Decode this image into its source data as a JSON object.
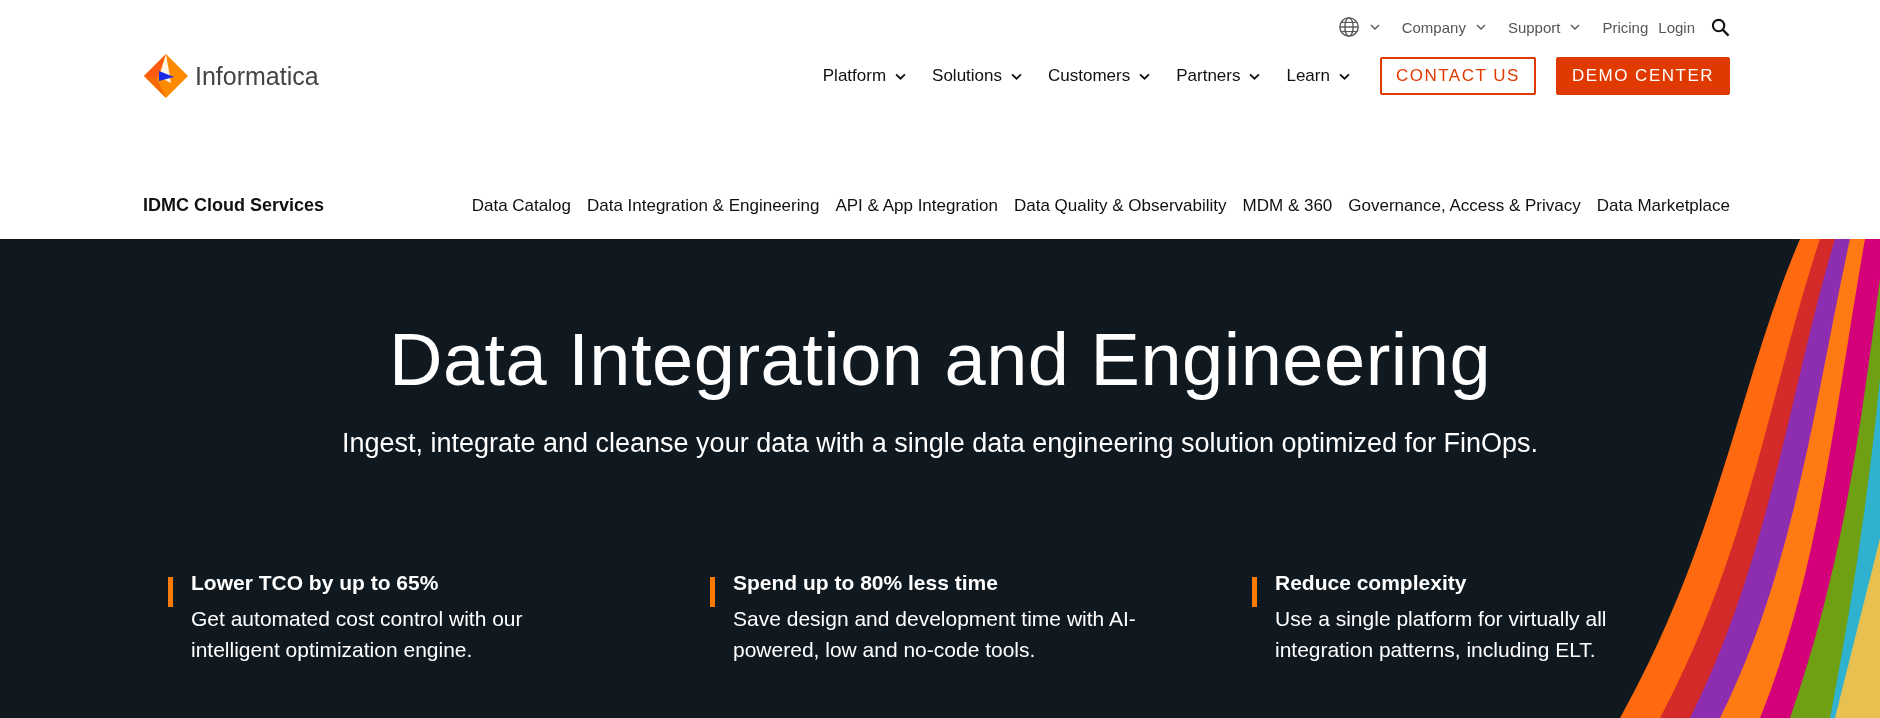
{
  "brand": {
    "name": "Informatica"
  },
  "utility_nav": [
    {
      "label": "Company",
      "dropdown": true
    },
    {
      "label": "Support",
      "dropdown": true
    },
    {
      "label": "Pricing",
      "dropdown": false
    },
    {
      "label": "Login",
      "dropdown": false
    }
  ],
  "main_nav": [
    {
      "label": "Platform"
    },
    {
      "label": "Solutions"
    },
    {
      "label": "Customers"
    },
    {
      "label": "Partners"
    },
    {
      "label": "Learn"
    }
  ],
  "buttons": [
    {
      "label": "CONTACT US",
      "kind": "outline"
    },
    {
      "label": "DEMO CENTER",
      "kind": "filled"
    }
  ],
  "sub_nav": {
    "title": "IDMC Cloud Services",
    "items": [
      "Data Catalog",
      "Data Integration & Engineering",
      "API & App Integration",
      "Data Quality & Observability",
      "MDM & 360",
      "Governance, Access & Privacy",
      "Data Marketplace"
    ]
  },
  "hero": {
    "title": "Data Integration and Engineering",
    "subtitle": "Ingest, integrate and cleanse your data with a single data engineering solution optimized for FinOps.",
    "features": [
      {
        "heading": "Lower TCO by up to 65%",
        "text": "Get automated cost control with our intelligent optimization engine."
      },
      {
        "heading": "Spend up to 80% less time",
        "text": "Save design and development time with AI-powered, low and no-code tools."
      },
      {
        "heading": "Reduce complexity",
        "text": "Use a single platform for virtually all integration patterns, including ELT."
      }
    ]
  }
}
